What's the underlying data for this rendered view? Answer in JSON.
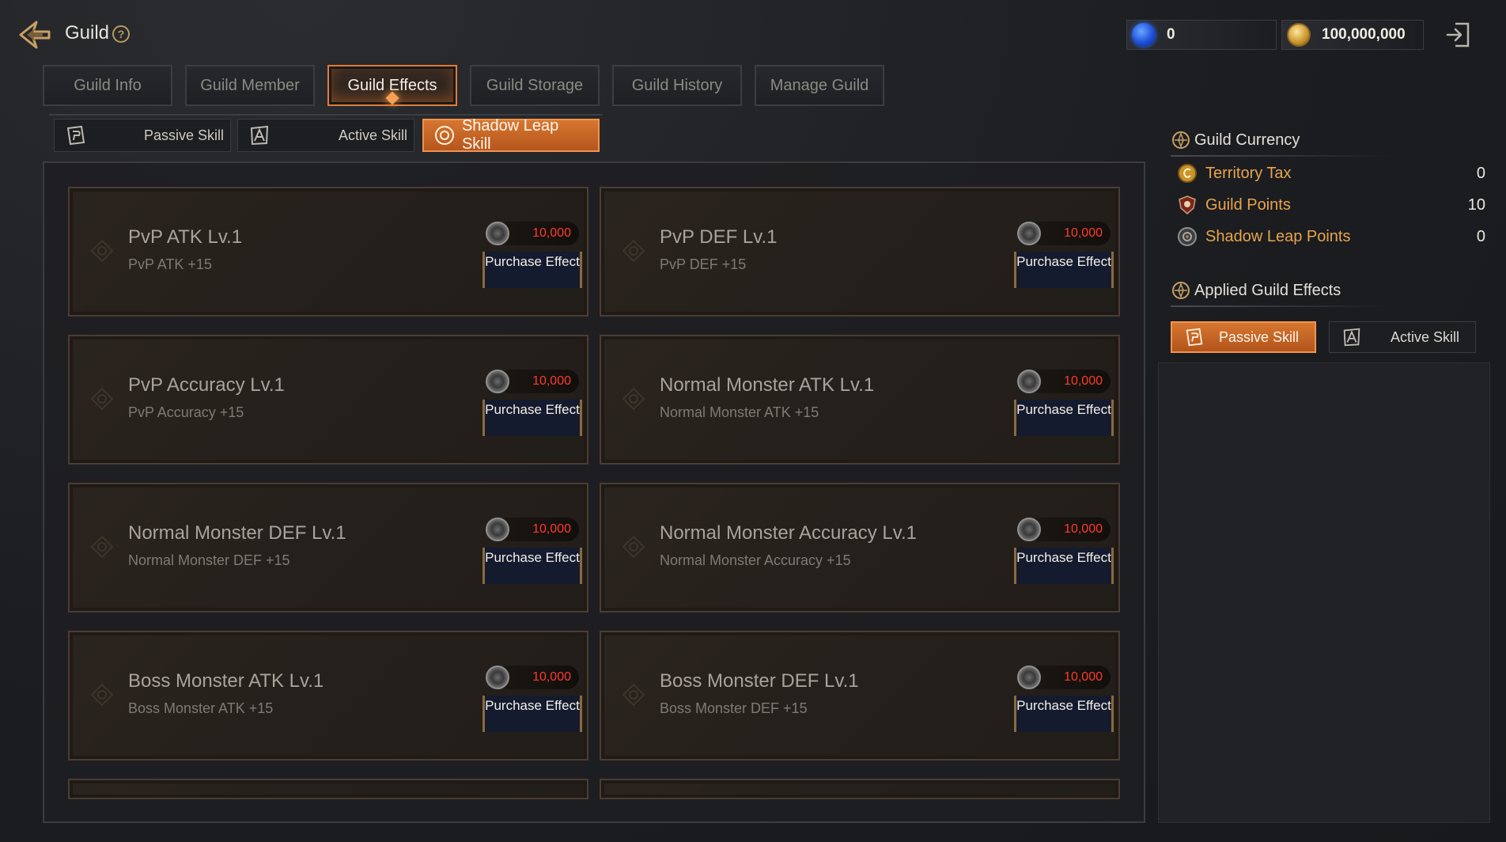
{
  "header": {
    "title": "Guild",
    "gem_amount": "0",
    "gold_amount": "100,000,000"
  },
  "tabs": [
    {
      "label": "Guild Info"
    },
    {
      "label": "Guild Member"
    },
    {
      "label": "Guild Effects"
    },
    {
      "label": "Guild Storage"
    },
    {
      "label": "Guild History"
    },
    {
      "label": "Manage Guild"
    }
  ],
  "subtabs": [
    {
      "label": "Passive Skill"
    },
    {
      "label": "Active Skill"
    },
    {
      "label": "Shadow Leap Skill"
    }
  ],
  "effects": [
    {
      "name": "PvP ATK Lv.1",
      "desc": "PvP ATK +15",
      "price": "10,000",
      "button": "Purchase Effect"
    },
    {
      "name": "PvP DEF Lv.1",
      "desc": "PvP DEF +15",
      "price": "10,000",
      "button": "Purchase Effect"
    },
    {
      "name": "PvP Accuracy Lv.1",
      "desc": "PvP Accuracy +15",
      "price": "10,000",
      "button": "Purchase Effect"
    },
    {
      "name": "Normal Monster ATK Lv.1",
      "desc": "Normal Monster ATK +15",
      "price": "10,000",
      "button": "Purchase Effect"
    },
    {
      "name": "Normal Monster DEF Lv.1",
      "desc": "Normal Monster DEF +15",
      "price": "10,000",
      "button": "Purchase Effect"
    },
    {
      "name": "Normal Monster Accuracy Lv.1",
      "desc": "Normal Monster Accuracy +15",
      "price": "10,000",
      "button": "Purchase Effect"
    },
    {
      "name": "Boss Monster ATK Lv.1",
      "desc": "Boss Monster ATK +15",
      "price": "10,000",
      "button": "Purchase Effect"
    },
    {
      "name": "Boss Monster DEF Lv.1",
      "desc": "Boss Monster DEF +15",
      "price": "10,000",
      "button": "Purchase Effect"
    }
  ],
  "guild_currency": {
    "title": "Guild Currency",
    "rows": [
      {
        "label": "Territory Tax",
        "value": "0"
      },
      {
        "label": "Guild Points",
        "value": "10"
      },
      {
        "label": "Shadow Leap Points",
        "value": "0"
      }
    ]
  },
  "applied_effects": {
    "title": "Applied Guild Effects",
    "tabs": [
      {
        "label": "Passive Skill"
      },
      {
        "label": "Active Skill"
      }
    ]
  },
  "colors": {
    "accent": "#e27a3a",
    "price_red": "#ff3a2a",
    "currency_label": "#e8a44c"
  }
}
